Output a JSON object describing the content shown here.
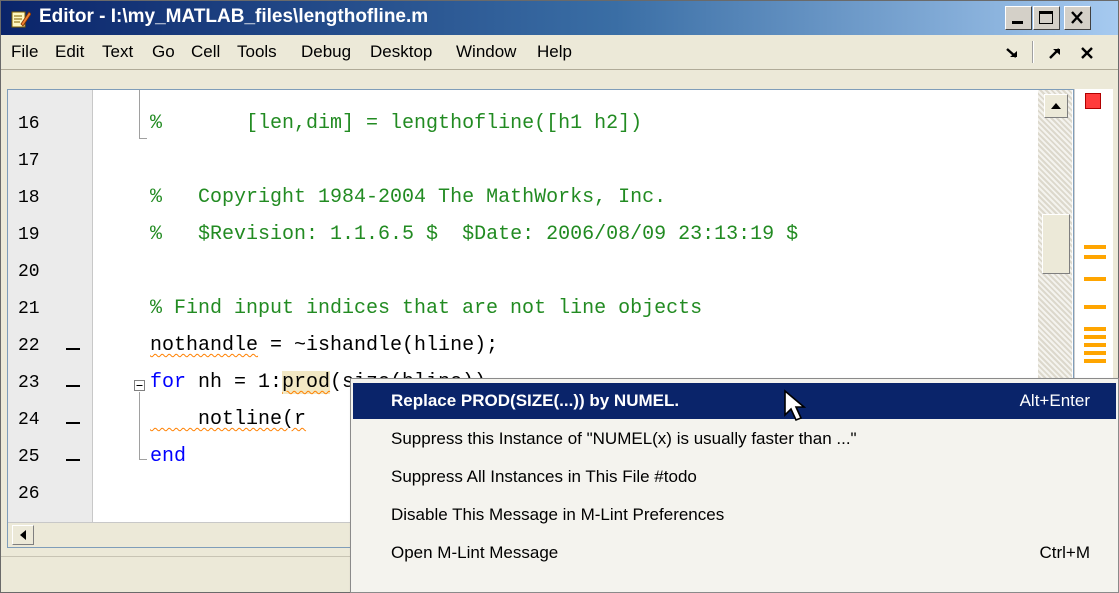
{
  "window": {
    "title": "Editor - I:\\my_MATLAB_files\\lengthofline.m",
    "app_icon": "matlab-editor-icon",
    "controls": [
      "minimize-icon",
      "maximize-icon",
      "close-icon"
    ]
  },
  "menubar": {
    "items": [
      "File",
      "Edit",
      "Text",
      "Go",
      "Cell",
      "Tools",
      "Debug",
      "Desktop",
      "Window",
      "Help"
    ],
    "dock_icon": "dock-arrow-icon",
    "undock_icon": "undock-arrow-icon",
    "close_glyph": "×"
  },
  "editor": {
    "line_numbers": [
      "16",
      "17",
      "18",
      "19",
      "20",
      "21",
      "22",
      "23",
      "24",
      "25",
      "26"
    ],
    "breakpoint_marker": "—",
    "lines": {
      "l16_pct": "%",
      "l16_code": "       [len,dim] = lengthofline([h1 h2])",
      "l18_pct": "%",
      "l18_code": "   Copyright 1984-2004 The MathWorks, Inc.",
      "l19_pct": "%",
      "l19_code": "   $Revision: 1.1.6.5 $  $Date: 2006/08/09 23:13:19 $",
      "l21": "% Find input indices that are not line objects",
      "l22_var": "nothandle",
      "l22_rest": " = ~ishandle(hline);",
      "l23_kw": "for",
      "l23_a": " nh = 1:",
      "l23_hl": "prod",
      "l23_b": "(size(hline))",
      "l24_a": "    notline(r",
      "l25_kw": "end"
    }
  },
  "mlint": {
    "status_color": "#ff3b3b",
    "marker_color": "#ffa500"
  },
  "context_menu": {
    "items": [
      {
        "label": "Replace PROD(SIZE(...)) by NUMEL.",
        "shortcut": "Alt+Enter",
        "selected": true
      },
      {
        "label": "Suppress this Instance of \"NUMEL(x) is usually faster than ...\"",
        "shortcut": ""
      },
      {
        "label": "Suppress All Instances in This File #todo",
        "shortcut": ""
      },
      {
        "label": "Disable This Message in M-Lint Preferences",
        "shortcut": ""
      },
      {
        "label": "Open M-Lint Message",
        "shortcut": "Ctrl+M"
      }
    ],
    "selected_color": "#0a246a"
  },
  "cursor_icon": "mouse-pointer-icon"
}
